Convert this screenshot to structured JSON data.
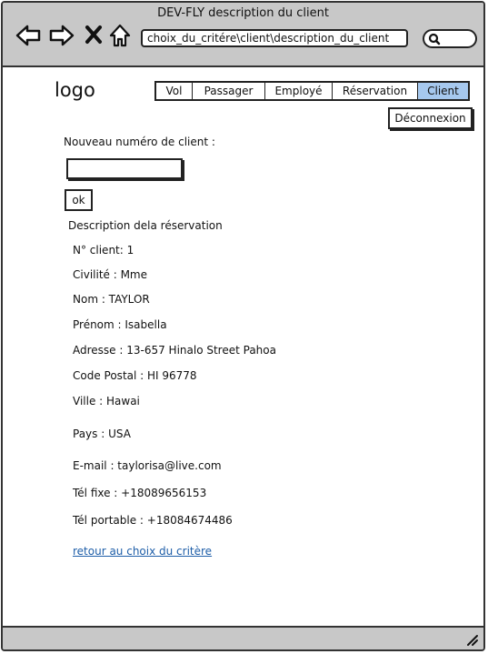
{
  "window": {
    "title": "DEV-FLY description du client"
  },
  "browser": {
    "url": "choix_du_critére\\client\\description_du_client"
  },
  "header": {
    "logo": "logo"
  },
  "nav": {
    "tabs": [
      {
        "label": "Vol",
        "active": false
      },
      {
        "label": "Passager",
        "active": false
      },
      {
        "label": "Employé",
        "active": false
      },
      {
        "label": "Réservation",
        "active": false
      },
      {
        "label": "Client",
        "active": true
      }
    ]
  },
  "actions": {
    "logout_label": "Déconnexion"
  },
  "form": {
    "new_client_label": "Nouveau numéro de client :",
    "client_number_value": "",
    "ok_label": "ok"
  },
  "details": {
    "heading": "Description dela réservation",
    "client_number": "N° client: 1",
    "civility": "Civilité : Mme",
    "last_name": "Nom : TAYLOR",
    "first_name": "Prénom : Isabella",
    "address": "Adresse : 13-657 Hinalo Street Pahoa",
    "postal_code": "Code Postal : HI 96778",
    "city": "Ville : Hawai",
    "country": "Pays : USA",
    "email": "E-mail : taylorisa@live.com",
    "phone_home": "Tél fixe : +18089656153",
    "phone_mobile": "Tél portable : +18084674486"
  },
  "links": {
    "back_to_criteria": "retour au choix du critère"
  },
  "colors": {
    "active_tab": "#a6c8ee",
    "link": "#1e5ea8",
    "chrome": "#c8c8c8"
  }
}
